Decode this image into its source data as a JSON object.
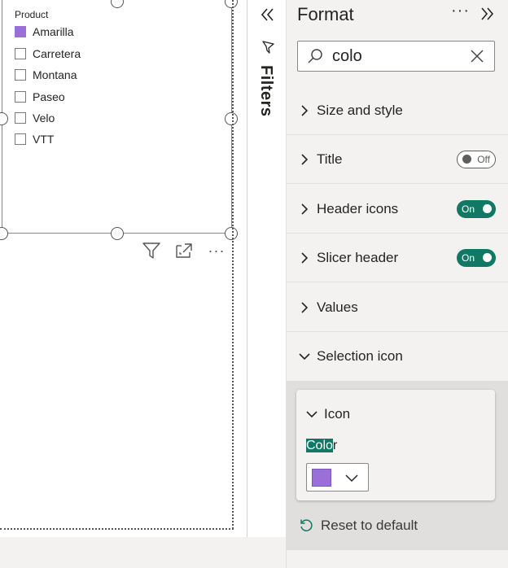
{
  "slicer": {
    "title": "Product",
    "items": [
      {
        "label": "Amarilla",
        "checked": true
      },
      {
        "label": "Carretera",
        "checked": false
      },
      {
        "label": "Montana",
        "checked": false
      },
      {
        "label": "Paseo",
        "checked": false
      },
      {
        "label": "Velo",
        "checked": false
      },
      {
        "label": "VTT",
        "checked": false
      }
    ],
    "selected_color": "#9b6fd8"
  },
  "visual_toolbar": {
    "icons": [
      "filter-icon",
      "focus-mode-icon",
      "more-options-icon"
    ],
    "more_label": "···"
  },
  "filters": {
    "label": "Filters",
    "icons": [
      "double-chevron-left-icon",
      "funnel-icon"
    ]
  },
  "format_pane": {
    "title": "Format",
    "more_label": "···",
    "search": {
      "value": "colo",
      "placeholder": "Search"
    },
    "sections": [
      {
        "label": "Size and style",
        "expanded": false,
        "toggle": null
      },
      {
        "label": "Title",
        "expanded": false,
        "toggle": "Off"
      },
      {
        "label": "Header icons",
        "expanded": false,
        "toggle": "On"
      },
      {
        "label": "Slicer header",
        "expanded": false,
        "toggle": "On"
      },
      {
        "label": "Values",
        "expanded": false,
        "toggle": null
      },
      {
        "label": "Selection icon",
        "expanded": true,
        "toggle": null
      }
    ],
    "icon_card": {
      "header": "Icon",
      "color_label_highlight": "Colo",
      "color_label_rest": "r",
      "color_value": "#9b6fd8"
    },
    "reset_label": "Reset to default",
    "accent_color": "#117865"
  }
}
